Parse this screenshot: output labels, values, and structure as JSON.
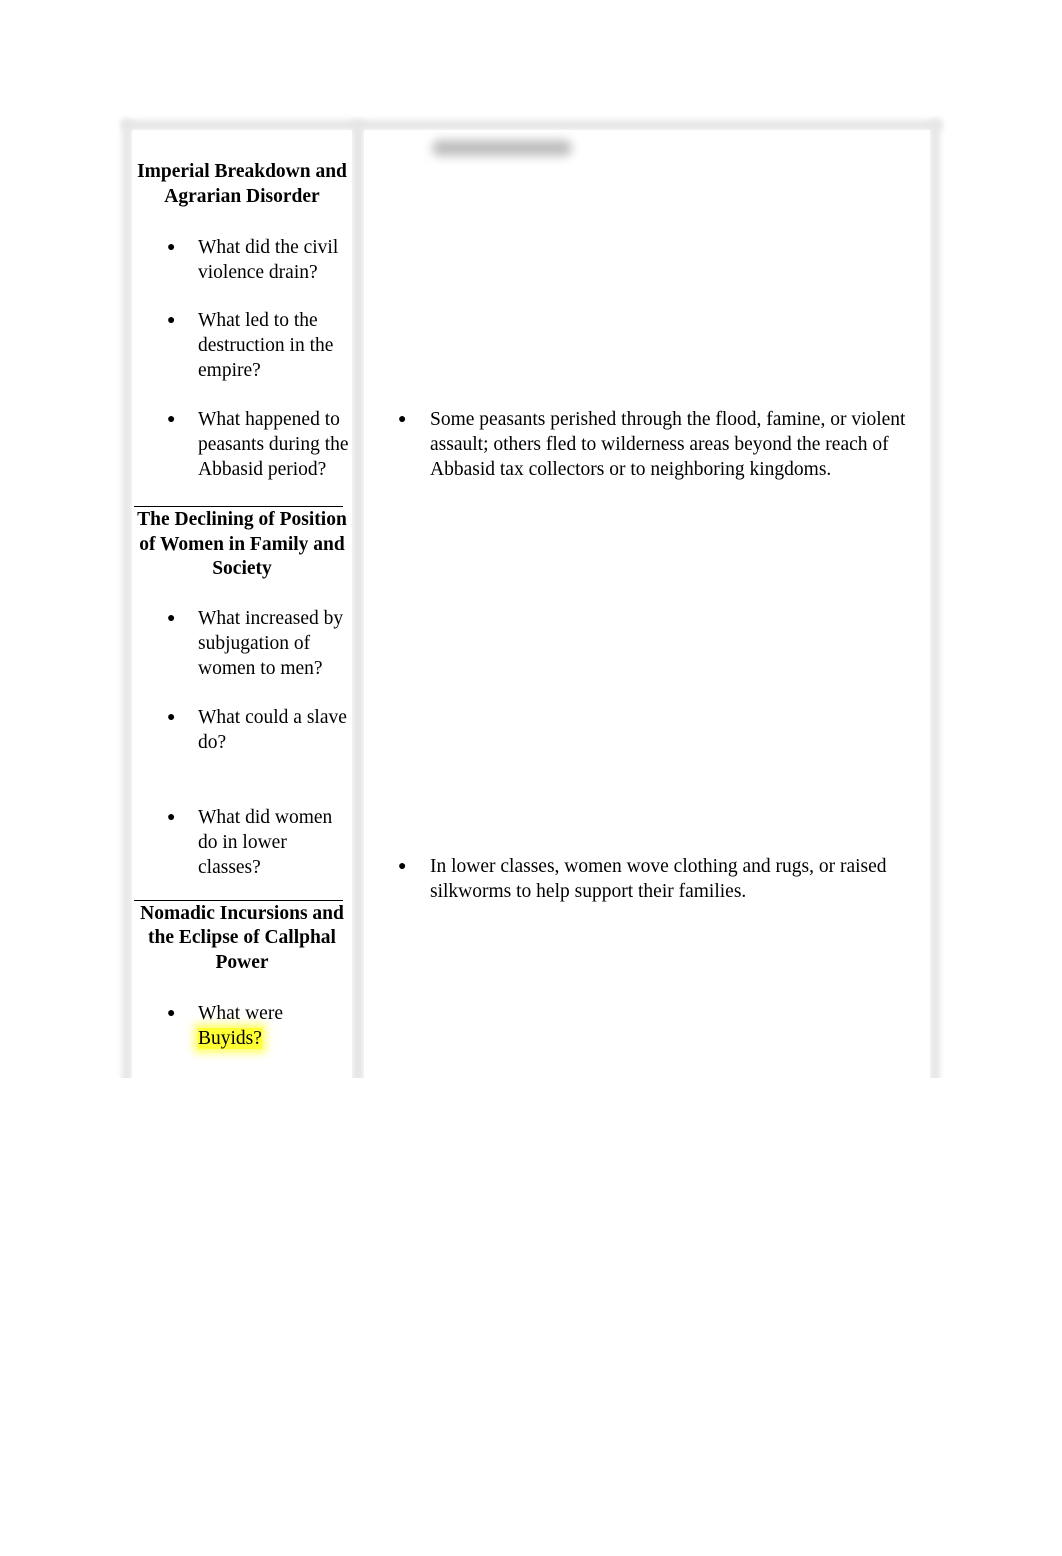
{
  "sections": [
    {
      "title": "Imperial Breakdown and Agrarian Disorder",
      "questions": [
        "What did the civil violence drain?",
        "What led to the destruction in the empire?",
        "What happened to peasants during the Abbasid period?"
      ]
    },
    {
      "title": "The Declining of Position of Women in Family and Society",
      "questions": [
        "What increased by subjugation of women to men?",
        "What could a slave do?",
        "What did women do in lower classes?"
      ]
    },
    {
      "title": "Nomadic Incursions and the Eclipse of Callphal Power",
      "questions": [
        {
          "before": "What were ",
          "highlight": "Buyids?"
        }
      ]
    }
  ],
  "answers": [
    "Some peasants perished through the flood, famine, or violent assault; others fled to wilderness areas beyond the reach of Abbasid tax collectors or to neighboring kingdoms.",
    "In lower classes, women wove clothing and rugs, or raised silkworms to help support their families."
  ],
  "bullet_glyph": "●",
  "colors": {
    "highlight": "#ffff33",
    "border_shadow": "#e6e6e6"
  }
}
